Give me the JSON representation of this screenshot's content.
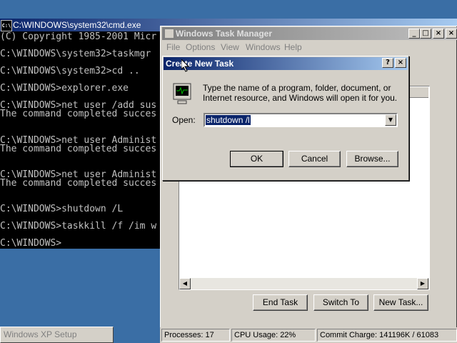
{
  "cmd": {
    "title": "C:\\WINDOWS\\system32\\cmd.exe",
    "icon_label": "C:\\",
    "lines": [
      "(C) Copyright 1985-2001 Micr",
      "",
      "C:\\WINDOWS\\system32>taskmgr",
      "",
      "C:\\WINDOWS\\system32>cd ..",
      "",
      "C:\\WINDOWS>explorer.exe",
      "",
      "C:\\WINDOWS>net user /add sus",
      "The command completed succes",
      "",
      "",
      "C:\\WINDOWS>net user Administ",
      "The command completed succes",
      "",
      "",
      "C:\\WINDOWS>net user Administ",
      "The command completed succes",
      "",
      "",
      "C:\\WINDOWS>shutdown /L",
      "",
      "C:\\WINDOWS>taskkill /f /im w",
      "",
      "C:\\WINDOWS>"
    ]
  },
  "task_manager": {
    "title": "Windows Task Manager",
    "menu": [
      "File",
      "Options",
      "View",
      "Windows",
      "Help"
    ],
    "buttons": {
      "end_task": "End Task",
      "switch_to": "Switch To",
      "new_task": "New Task..."
    },
    "status": {
      "processes": "Processes: 17",
      "cpu": "CPU Usage: 22%",
      "commit": "Commit Charge: 141196K / 61083"
    }
  },
  "dialog": {
    "title": "Create New Task",
    "message": "Type the name of a program, folder, document, or Internet resource, and Windows will open it for you.",
    "open_label": "Open:",
    "open_value": "shutdown /l",
    "ok": "OK",
    "cancel": "Cancel",
    "browse": "Browse..."
  },
  "taskbar": {
    "setup_label": "Windows XP Setup"
  },
  "colors": {
    "desktop": "#3a6ea5",
    "active_title": "#0a246a",
    "inactive_title": "#808080",
    "face": "#d4d0c8"
  }
}
